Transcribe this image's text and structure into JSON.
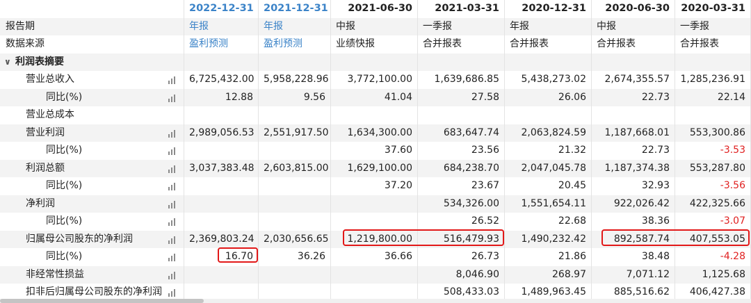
{
  "columns": [
    {
      "date": "2022-12-31",
      "forecast": true
    },
    {
      "date": "2021-12-31",
      "forecast": true
    },
    {
      "date": "2021-06-30",
      "forecast": false
    },
    {
      "date": "2021-03-31",
      "forecast": false
    },
    {
      "date": "2020-12-31",
      "forecast": false
    },
    {
      "date": "2020-06-30",
      "forecast": false
    },
    {
      "date": "2020-03-31",
      "forecast": false
    }
  ],
  "meta_rows": [
    {
      "label": "报告期",
      "values": [
        "年报",
        "年报",
        "中报",
        "一季报",
        "年报",
        "中报",
        "一季报"
      ]
    },
    {
      "label": "数据来源",
      "values": [
        "盈利预测",
        "盈利预测",
        "业绩快报",
        "合并报表",
        "合并报表",
        "合并报表",
        "合并报表"
      ]
    }
  ],
  "section": {
    "label": "利润表摘要",
    "caret": "∨"
  },
  "rows": [
    {
      "label": "营业总收入",
      "indent": 1,
      "chart": true,
      "values": [
        "6,725,432.00",
        "5,958,228.96",
        "3,772,100.00",
        "1,639,686.85",
        "5,438,273.02",
        "2,674,355.57",
        "1,285,236.91"
      ]
    },
    {
      "label": "同比(%)",
      "indent": 2,
      "chart": true,
      "values": [
        "12.88",
        "9.56",
        "41.04",
        "27.58",
        "26.06",
        "22.73",
        "22.14"
      ]
    },
    {
      "label": "营业总成本",
      "indent": 1,
      "chart": false,
      "values": [
        "",
        "",
        "",
        "",
        "",
        "",
        ""
      ]
    },
    {
      "label": "营业利润",
      "indent": 1,
      "chart": true,
      "values": [
        "2,989,056.53",
        "2,551,917.50",
        "1,634,300.00",
        "683,647.74",
        "2,063,824.59",
        "1,187,668.01",
        "553,300.86"
      ]
    },
    {
      "label": "同比(%)",
      "indent": 2,
      "chart": true,
      "values": [
        "",
        "",
        "37.60",
        "23.56",
        "21.32",
        "22.73",
        "-3.53"
      ]
    },
    {
      "label": "利润总额",
      "indent": 1,
      "chart": true,
      "values": [
        "3,037,383.48",
        "2,603,815.00",
        "1,629,100.00",
        "684,238.70",
        "2,047,045.78",
        "1,187,374.38",
        "553,287.80"
      ]
    },
    {
      "label": "同比(%)",
      "indent": 2,
      "chart": true,
      "values": [
        "",
        "",
        "37.20",
        "23.67",
        "20.45",
        "32.93",
        "-3.56"
      ]
    },
    {
      "label": "净利润",
      "indent": 1,
      "chart": true,
      "values": [
        "",
        "",
        "",
        "534,326.00",
        "1,551,654.11",
        "922,026.42",
        "422,325.66"
      ]
    },
    {
      "label": "同比(%)",
      "indent": 2,
      "chart": true,
      "values": [
        "",
        "",
        "",
        "26.52",
        "22.68",
        "38.36",
        "-3.07"
      ]
    },
    {
      "label": "归属母公司股东的净利润",
      "indent": 1,
      "chart": true,
      "values": [
        "2,369,803.24",
        "2,030,656.65",
        "1,219,800.00",
        "516,479.93",
        "1,490,232.42",
        "892,587.74",
        "407,553.05"
      ]
    },
    {
      "label": "同比(%)",
      "indent": 2,
      "chart": true,
      "values": [
        "16.70",
        "36.26",
        "36.66",
        "26.73",
        "21.86",
        "38.48",
        "-4.28"
      ]
    },
    {
      "label": "非经常性损益",
      "indent": 1,
      "chart": true,
      "values": [
        "",
        "",
        "",
        "8,046.90",
        "268.97",
        "7,071.12",
        "1,125.68"
      ]
    },
    {
      "label": "扣非后归属母公司股东的净利润",
      "indent": 1,
      "chart": true,
      "values": [
        "",
        "",
        "",
        "508,433.03",
        "1,489,963.45",
        "885,516.62",
        "406,427.38"
      ]
    }
  ],
  "colors": {
    "forecast_header": "#3b83c8",
    "negative": "#e02020",
    "highlight": "#e21818"
  }
}
